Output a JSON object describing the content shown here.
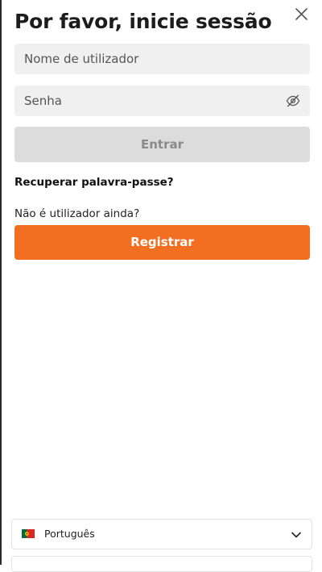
{
  "login": {
    "title": "Por favor, inicie sessão",
    "username_placeholder": "Nome de utilizador",
    "password_placeholder": "Senha",
    "login_button": "Entrar",
    "recover_link": "Recuperar palavra-passe?",
    "no_account_text": "Não é utilizador ainda?",
    "register_button": "Registrar"
  },
  "language": {
    "selected": "Português",
    "flag": "portugal-flag-icon"
  },
  "icons": {
    "close": "close-icon",
    "password_visibility": "eye-off-icon",
    "dropdown": "chevron-down-icon"
  },
  "colors": {
    "accent": "#f26f21",
    "disabled_button": "#dcdcdc",
    "input_background": "#f0f0f0"
  }
}
